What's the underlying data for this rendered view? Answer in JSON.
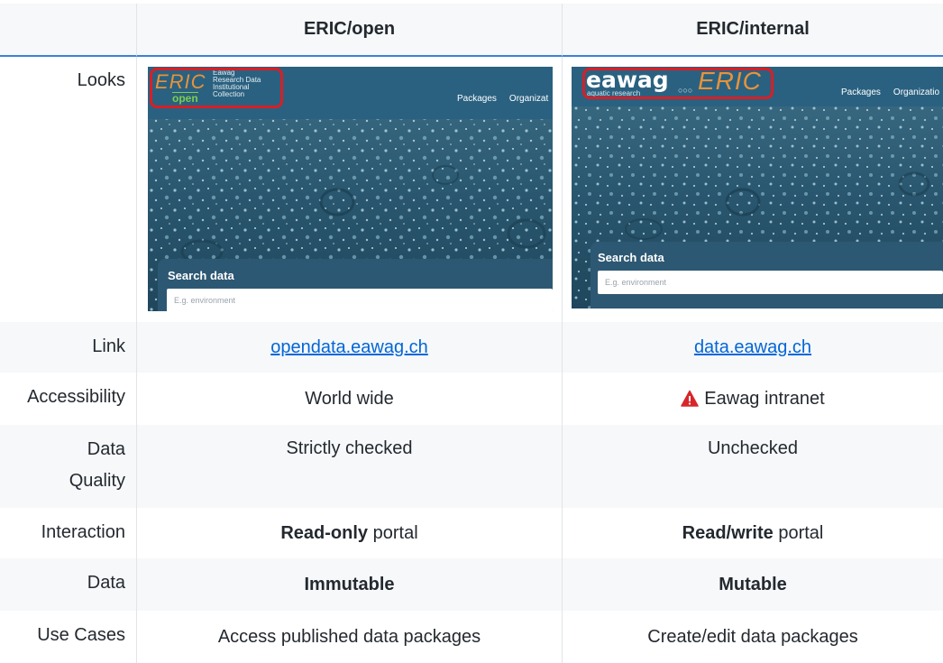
{
  "table": {
    "headers": [
      "",
      "ERIC/open",
      "ERIC/internal"
    ],
    "rows": [
      {
        "label": "Looks"
      },
      {
        "label": "Link",
        "open": "opendata.eawag.ch",
        "internal": "data.eawag.ch"
      },
      {
        "label": "Accessibility",
        "open": "World wide",
        "internal": "Eawag intranet"
      },
      {
        "label_line1": "Data",
        "label_line2": "Quality",
        "open": "Strictly checked",
        "internal": "Unchecked"
      },
      {
        "label": "Interaction",
        "open_bold": "Read-only",
        "open_rest": " portal",
        "internal_bold": "Read/write",
        "internal_rest": " portal"
      },
      {
        "label": "Data",
        "open": "Immutable",
        "internal": "Mutable"
      },
      {
        "label": "Use Cases",
        "open": "Access published data packages",
        "internal": "Create/edit data packages"
      }
    ]
  },
  "screens": {
    "open": {
      "logo_main": "ERIC",
      "logo_sub": "open",
      "logo_text": [
        "Eawag",
        "Research Data",
        "Institutional",
        "Collection"
      ],
      "nav": [
        "Packages",
        "Organizat"
      ],
      "search_title": "Search data",
      "search_placeholder": "E.g. environment"
    },
    "internal": {
      "logo_main": "eawag",
      "logo_tagline": "aquatic research",
      "logo_eric": "ERIC",
      "nav": [
        "Packages",
        "Organizatio"
      ],
      "search_title": "Search data",
      "search_placeholder": "E.g. environment"
    }
  },
  "colors": {
    "accent_rule": "#3b82d6",
    "link": "#0366d6",
    "highlight_box": "#d81f26",
    "warning": "#d7262a"
  },
  "icons": {
    "warning": "warning-triangle-icon"
  }
}
